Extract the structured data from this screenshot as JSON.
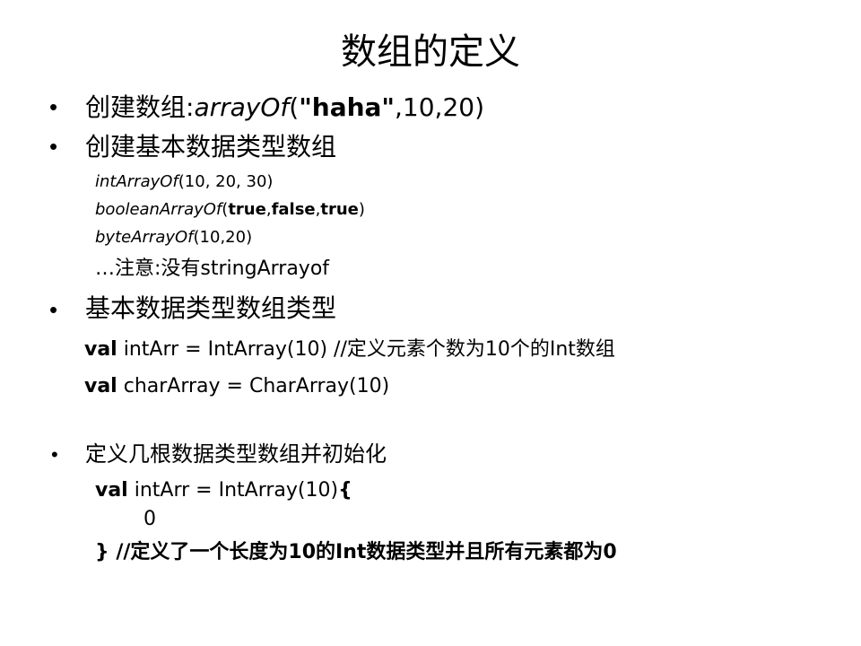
{
  "title": "数组的定义",
  "b1": {
    "prefix": "创建数组:",
    "func": "arrayOf",
    "open": "(",
    "str": "\"haha\"",
    "rest": ",10,20)"
  },
  "b2": {
    "text": "创建基本数据类型数组",
    "l1": {
      "func": "intArrayOf",
      "args": "(10, 20, 30)"
    },
    "l2": {
      "func": "booleanArrayOf",
      "open": "(",
      "a1": "true",
      "c1": ",",
      "a2": "false",
      "c2": ",",
      "a3": "true",
      "close": ")"
    },
    "l3": {
      "func": "byteArrayOf",
      "args": "(10,20)"
    },
    "note": "…注意:没有stringArrayof"
  },
  "b3": {
    "text": "基本数据类型数组类型",
    "c1": {
      "kw": "val",
      "rest": " intArr = IntArray(10)  //定义元素个数为10个的Int数组"
    },
    "c2": {
      "kw": "val",
      "rest": " charArray = CharArray(10)"
    }
  },
  "b4": {
    "text": "定义几根数据类型数组并初始化",
    "c1": {
      "kw": "val",
      "rest": " intArr = IntArray(10)",
      "brace": "{"
    },
    "c2": "0",
    "c3": {
      "brace": "}",
      "comment": "  //定义了一个长度为10的Int数据类型并且所有元素都为0"
    }
  },
  "bullet_char": "•"
}
